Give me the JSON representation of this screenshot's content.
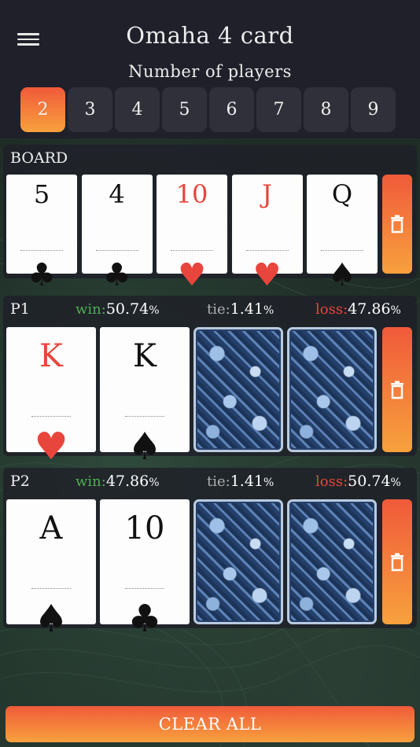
{
  "header": {
    "title": "Omaha 4 card",
    "subtitle": "Number of players",
    "player_options": [
      "2",
      "3",
      "4",
      "5",
      "6",
      "7",
      "8",
      "9"
    ],
    "selected_players": "2"
  },
  "board": {
    "label": "BOARD",
    "cards": [
      {
        "rank": "5",
        "suit": "clubs",
        "symbol": "♣",
        "color": "black"
      },
      {
        "rank": "4",
        "suit": "clubs",
        "symbol": "♣",
        "color": "black"
      },
      {
        "rank": "10",
        "suit": "hearts",
        "symbol": "♥",
        "color": "red"
      },
      {
        "rank": "J",
        "suit": "hearts",
        "symbol": "♥",
        "color": "red"
      },
      {
        "rank": "Q",
        "suit": "spades",
        "symbol": "♠",
        "color": "black"
      }
    ],
    "delete_icon": "trash-icon"
  },
  "players": [
    {
      "label": "P1",
      "win_label": "win:",
      "win_value": "50.74",
      "win_pct": "%",
      "tie_label": "tie:",
      "tie_value": "1.41",
      "tie_pct": "%",
      "loss_label": "loss:",
      "loss_value": "47.86",
      "loss_pct": "%",
      "cards": [
        {
          "rank": "K",
          "suit": "hearts",
          "symbol": "♥",
          "color": "red"
        },
        {
          "rank": "K",
          "suit": "spades",
          "symbol": "♠",
          "color": "black"
        }
      ],
      "face_down": 2
    },
    {
      "label": "P2",
      "win_label": "win:",
      "win_value": "47.86",
      "win_pct": "%",
      "tie_label": "tie:",
      "tie_value": "1.41",
      "tie_pct": "%",
      "loss_label": "loss:",
      "loss_value": "50.74",
      "loss_pct": "%",
      "cards": [
        {
          "rank": "A",
          "suit": "spades",
          "symbol": "♠",
          "color": "black"
        },
        {
          "rank": "10",
          "suit": "clubs",
          "symbol": "♣",
          "color": "black"
        }
      ],
      "face_down": 2
    }
  ],
  "colors": {
    "accent_top": "#f05a3a",
    "accent_bottom": "#f7a13d",
    "win": "#4caf50",
    "tie": "#b0b0b0",
    "loss": "#e8453c"
  },
  "footer": {
    "clear_label": "CLEAR ALL"
  }
}
